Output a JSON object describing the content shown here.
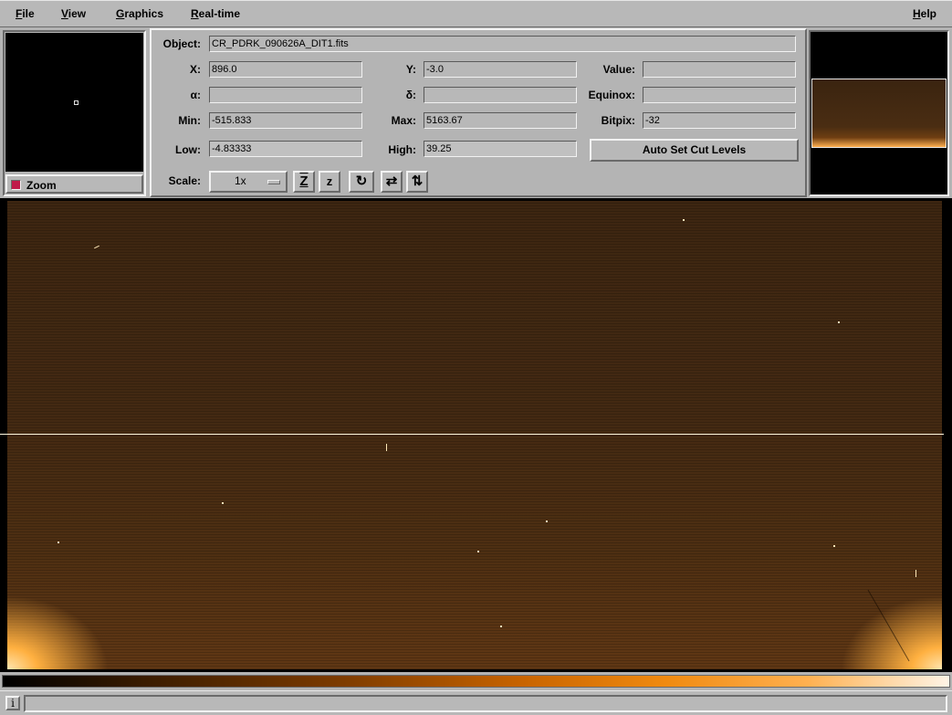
{
  "menu": {
    "file": {
      "mnemonic": "F",
      "rest": "ile"
    },
    "view": {
      "mnemonic": "V",
      "rest": "iew"
    },
    "graphics": {
      "mnemonic": "G",
      "rest": "raphics"
    },
    "realtime": {
      "mnemonic": "R",
      "rest": "eal-time"
    },
    "help": {
      "mnemonic": "H",
      "rest": "elp"
    }
  },
  "zoom": {
    "label": "Zoom",
    "checked": true
  },
  "info": {
    "object_label": "Object:",
    "object_value": "CR_PDRK_090626A_DIT1.fits",
    "x_label": "X:",
    "x_value": "896.0",
    "y_label": "Y:",
    "y_value": "-3.0",
    "value_label": "Value:",
    "value_value": "",
    "alpha_label": "α:",
    "alpha_value": "",
    "delta_label": "δ:",
    "delta_value": "",
    "equinox_label": "Equinox:",
    "equinox_value": "",
    "min_label": "Min:",
    "min_value": "-515.833",
    "max_label": "Max:",
    "max_value": "5163.67",
    "bitpix_label": "Bitpix:",
    "bitpix_value": "-32",
    "low_label": "Low:",
    "low_value": "-4.83333",
    "high_label": "High:",
    "high_value": "39.25",
    "autoset_label": "Auto Set Cut Levels",
    "scale_label": "Scale:",
    "scale_value": "1x"
  },
  "tools": {
    "zoom_in_glyph": "Z",
    "zoom_out_glyph": "z",
    "rotate_glyph": "↻",
    "flip_x_glyph": "⇄",
    "flip_y_glyph": "⇅"
  },
  "status": {
    "icon_glyph": "i",
    "text": ""
  },
  "colors": {
    "image_base": "#432912",
    "colormap_high": "#ffb050",
    "panel_gray": "#b4b4b4"
  }
}
